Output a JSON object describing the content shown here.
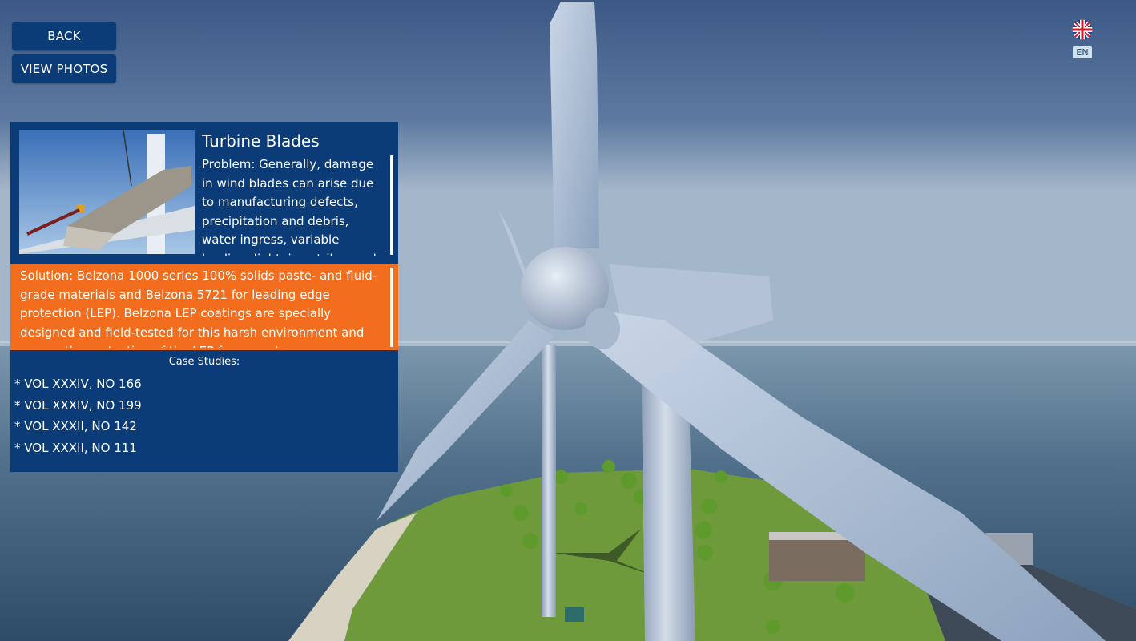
{
  "nav": {
    "back_label": "BACK",
    "photos_label": "VIEW PHOTOS"
  },
  "language": {
    "flag_icon": "uk-flag-icon",
    "code": "EN"
  },
  "panel": {
    "title": "Turbine Blades",
    "problem": "Problem: Generally, damage in wind blades can arise due to manufacturing defects, precipitation and debris, water ingress, variable loading, lightning strikes and erosion of the leading edge.",
    "solution": "Solution: Belzona 1000 series 100% solids paste- and fluid-grade materials and Belzona 5721 for leading edge protection (LEP). Belzona LEP coatings are specially designed and field-tested for this harsh environment and ensure the protection of the LEP for years to come.",
    "case_studies_header": "Case Studies:",
    "case_studies": [
      "* VOL XXXIV, NO 166",
      "* VOL XXXIV, NO 199",
      "* VOL XXXII, NO 142",
      "* VOL XXXII, NO 111"
    ]
  },
  "colors": {
    "panel_bg": "#0b3c78",
    "solution_bg": "#f26d1e",
    "button_bg": "#0b3c78"
  }
}
